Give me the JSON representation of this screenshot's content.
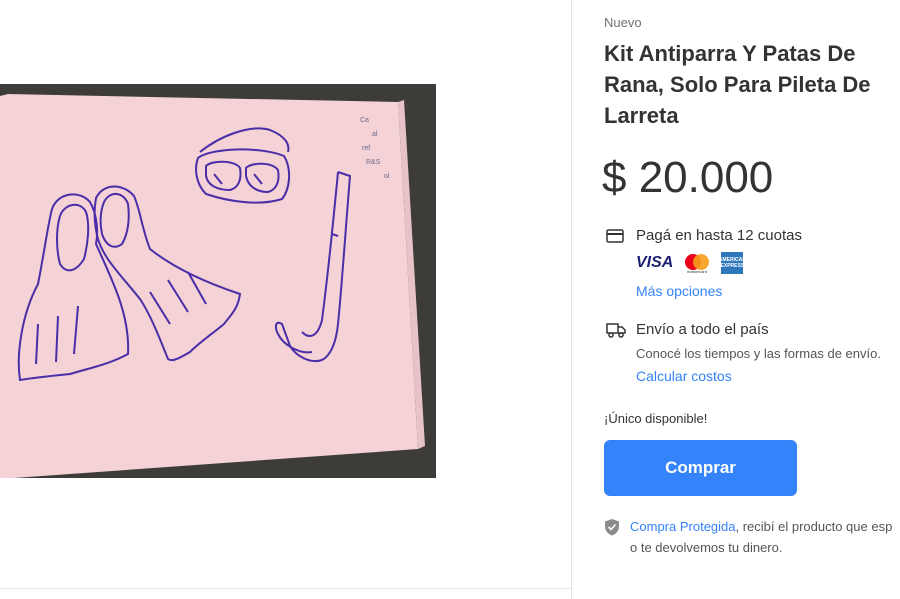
{
  "product": {
    "condition": "Nuevo",
    "title": "Kit Antiparra Y Patas De Rana, Solo Para Pileta De Larreta",
    "price": "$ 20.000"
  },
  "payment": {
    "title": "Pagá en hasta 12 cuotas",
    "cards": {
      "visa": "VISA",
      "mastercard": "mastercard",
      "amex": "AMERICAN EXPRESS"
    },
    "more_options": "Más opciones"
  },
  "shipping": {
    "title": "Envío a todo el país",
    "subtitle": "Conocé los tiempos y las formas de envío.",
    "calculate": "Calcular costos"
  },
  "stock": {
    "label": "¡Único disponible!"
  },
  "buy": {
    "label": "Comprar"
  },
  "protection": {
    "link": "Compra Protegida",
    "text1": ", recibí el producto que esp",
    "text2": "o te devolvemos tu dinero."
  },
  "photo": {
    "notes": [
      "Ca",
      "al",
      "ref",
      "R&S",
      "ol"
    ]
  },
  "colors": {
    "accent": "#3483fa",
    "paper": "#f4d2d6",
    "ink": "#4a2ea8",
    "visa": "#1a1f71",
    "amex": "#2e77bb"
  },
  "icons": [
    "credit-card-icon",
    "delivery-truck-icon",
    "shield-check-icon",
    "visa-logo",
    "mastercard-logo",
    "amex-logo"
  ]
}
